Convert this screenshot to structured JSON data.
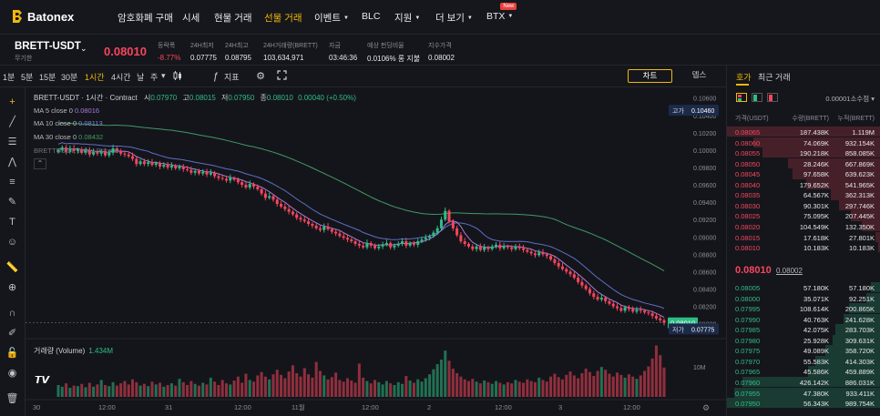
{
  "brand": {
    "name": "Batonex",
    "accent": "#f0b90b"
  },
  "nav": {
    "items": [
      {
        "label": "암호화폐 구매",
        "caret": false
      },
      {
        "label": "시세",
        "caret": false
      },
      {
        "label": "현물 거래",
        "caret": false
      },
      {
        "label": "선물 거래",
        "caret": false,
        "active": true
      },
      {
        "label": "이벤트",
        "caret": true
      },
      {
        "label": "BLC",
        "caret": false
      },
      {
        "label": "지원",
        "caret": true
      },
      {
        "label": "더 보기",
        "caret": true
      },
      {
        "label": "BTX",
        "caret": true,
        "badge": "New"
      }
    ]
  },
  "ticker": {
    "symbol": "BRETT-USDT",
    "subtitle": "무기한",
    "last_price": "0.08010",
    "stats": [
      {
        "label": "등락폭",
        "value": "-8.77%",
        "negative": true
      },
      {
        "label": "24H최저",
        "value": "0.07775"
      },
      {
        "label": "24H최고",
        "value": "0.08795"
      },
      {
        "label": "24H거래량(BRETT)",
        "value": "103,634,971"
      },
      {
        "label": "자금",
        "value": "03:46:36"
      },
      {
        "label": "예상 펀딩비율",
        "value": "0.0106% 롱 지불"
      },
      {
        "label": "지수가격",
        "value": "0.08002"
      }
    ]
  },
  "toolbar": {
    "timeframes": [
      "1분",
      "5분",
      "15분",
      "30분",
      "1시간",
      "4시간",
      "날",
      "주"
    ],
    "active_timeframe": "1시간",
    "indicator_label": "지표",
    "view_chart": "차트",
    "view_depth": "뎁스"
  },
  "chart_legend": {
    "title": "BRETT-USDT · 1시간 · Contract",
    "open_label": "시",
    "open": "0.07970",
    "high_label": "고",
    "high": "0.08015",
    "low_label": "저",
    "low": "0.07950",
    "close_label": "종",
    "close": "0.08010",
    "change": "0.00040 (+0.50%)",
    "ma5_label": "MA 5 close 0",
    "ma5": "0.08016",
    "ma10_label": "MA 10 close 0",
    "ma10": "0.08113",
    "ma30_label": "MA 30 close 0",
    "ma30": "0.08432",
    "index_label": "BRETTUSDT, Index Price",
    "volume_label": "거래량 (Volume)",
    "volume_value": "1.434M",
    "high_tag_label": "고가",
    "high_tag_value": "0.10460",
    "low_tag_label": "저가",
    "low_tag_value": "0.07775",
    "current_price_tag": "0.08010",
    "volume_axis_label": "10M"
  },
  "chart_data": {
    "type": "candlestick",
    "xlabel": "",
    "ylabel": "",
    "ylim": [
      0.0786,
      0.1066
    ],
    "y_ticks": [
      "0.10600",
      "0.10400",
      "0.10200",
      "0.10000",
      "0.09800",
      "0.09600",
      "0.09400",
      "0.09200",
      "0.09000",
      "0.08800",
      "0.08600",
      "0.08400",
      "0.08200",
      "0.08000"
    ],
    "x_ticks": [
      "30",
      "12:00",
      "31",
      "12:00",
      "11월",
      "12:00",
      "2",
      "12:00",
      "3",
      "12:00"
    ],
    "grid": false,
    "price_series": [
      0.1,
      0.1003,
      0.0998,
      0.1002,
      0.0999,
      0.1001,
      0.0997,
      0.1,
      0.0995,
      0.0998,
      0.0996,
      0.0999,
      0.0994,
      0.0997,
      0.1002,
      0.0999,
      0.0996,
      0.0995,
      0.0993,
      0.099,
      0.0984,
      0.0987,
      0.0984,
      0.0986,
      0.0983,
      0.0985,
      0.0981,
      0.0983,
      0.098,
      0.0982,
      0.0979,
      0.0981,
      0.0978,
      0.0977,
      0.0974,
      0.0976,
      0.0973,
      0.0975,
      0.0972,
      0.0974,
      0.097,
      0.0968,
      0.0967,
      0.0965,
      0.0968,
      0.0966,
      0.0963,
      0.096,
      0.0957,
      0.0961,
      0.0958,
      0.0955,
      0.095,
      0.0945,
      0.0947,
      0.0943,
      0.0938,
      0.0935,
      0.0932,
      0.0929,
      0.0926,
      0.0922,
      0.092,
      0.0918,
      0.0915,
      0.0913,
      0.091,
      0.0908,
      0.0912,
      0.0909,
      0.0906,
      0.0904,
      0.0901,
      0.0899,
      0.0897,
      0.0895,
      0.0892,
      0.089,
      0.0888,
      0.0893,
      0.089,
      0.0887,
      0.0889,
      0.0891,
      0.0893,
      0.0888,
      0.089,
      0.0892,
      0.0895,
      0.089,
      0.0893,
      0.0891,
      0.0895,
      0.0897,
      0.0899,
      0.0901,
      0.0905,
      0.091,
      0.092,
      0.093,
      0.0918,
      0.091,
      0.0902,
      0.0895,
      0.0892,
      0.0889,
      0.0886,
      0.0889,
      0.0885,
      0.0888,
      0.0886,
      0.0889,
      0.0891,
      0.0887,
      0.0889,
      0.0888,
      0.0886,
      0.0889,
      0.0887,
      0.0885,
      0.0883,
      0.0881,
      0.0879,
      0.0882,
      0.088,
      0.0878,
      0.0874,
      0.087,
      0.0866,
      0.0863,
      0.086,
      0.0857,
      0.0853,
      0.0848,
      0.0844,
      0.084,
      0.0835,
      0.0831,
      0.0828,
      0.083,
      0.0826,
      0.0823,
      0.082,
      0.0818,
      0.0815,
      0.0819,
      0.0817,
      0.0814,
      0.0816,
      0.0815,
      0.0813,
      0.0812,
      0.0809,
      0.0806,
      0.0804,
      0.0801
    ],
    "volume_series": [
      2.1,
      1.8,
      2.4,
      1.6,
      2.0,
      1.9,
      2.3,
      1.7,
      2.5,
      1.8,
      2.2,
      3.0,
      2.1,
      1.9,
      2.6,
      2.0,
      2.4,
      2.8,
      2.2,
      3.1,
      2.6,
      2.0,
      2.3,
      1.9,
      2.7,
      2.2,
      2.5,
      1.8,
      2.1,
      2.4,
      2.0,
      3.2,
      2.6,
      2.1,
      2.8,
      2.3,
      2.0,
      2.5,
      2.2,
      3.4,
      2.7,
      2.1,
      3.0,
      2.4,
      2.2,
      2.9,
      3.6,
      2.5,
      4.1,
      3.0,
      2.7,
      3.8,
      4.4,
      3.6,
      3.1,
      4.0,
      4.8,
      3.9,
      3.3,
      4.5,
      5.6,
      4.2,
      3.6,
      5.1,
      4.0,
      3.4,
      6.2,
      4.6,
      3.8,
      3.1,
      3.5,
      4.3,
      3.0,
      2.7,
      3.3,
      2.9,
      2.5,
      5.9,
      3.4,
      2.8,
      2.4,
      3.0,
      2.6,
      2.2,
      2.8,
      2.4,
      2.1,
      2.6,
      2.3,
      3.7,
      2.9,
      2.5,
      3.1,
      2.7,
      3.3,
      4.0,
      4.9,
      5.8,
      6.6,
      8.2,
      6.4,
      5.0,
      4.2,
      3.6,
      3.1,
      2.8,
      3.2,
      2.7,
      2.4,
      2.9,
      2.6,
      2.3,
      2.8,
      2.5,
      2.2,
      2.6,
      2.4,
      3.0,
      2.7,
      2.5,
      3.1,
      2.8,
      2.6,
      3.4,
      3.0,
      2.7,
      3.6,
      4.1,
      3.5,
      3.1,
      3.9,
      4.5,
      3.8,
      3.3,
      4.2,
      5.0,
      4.4,
      3.7,
      4.6,
      5.3,
      4.8,
      4.1,
      3.6,
      4.3,
      3.9,
      3.4,
      4.0,
      3.6,
      3.2,
      3.8,
      4.6,
      5.4,
      6.8,
      9.1,
      7.4,
      5.2
    ],
    "ma10_series_note": "",
    "ma30_series_note": ""
  },
  "orderbook": {
    "tab_book": "호가",
    "tab_trades": "최근 거래",
    "precision": "0.00001소수점",
    "col_price": "가격(USDT)",
    "col_size": "수량(BRETT)",
    "col_total": "누적(BRETT)",
    "mid_price": "0.08010",
    "mark_price": "0.08002",
    "asks": [
      {
        "price": "0.08065",
        "size": "187.438K",
        "total": "1.119M",
        "depth": 1.0
      },
      {
        "price": "0.08060",
        "size": "74.069K",
        "total": "932.154K",
        "depth": 0.83
      },
      {
        "price": "0.08055",
        "size": "190.218K",
        "total": "858.085K",
        "depth": 0.77
      },
      {
        "price": "0.08050",
        "size": "28.246K",
        "total": "667.869K",
        "depth": 0.6
      },
      {
        "price": "0.08045",
        "size": "97.658K",
        "total": "639.623K",
        "depth": 0.57
      },
      {
        "price": "0.08040",
        "size": "179.652K",
        "total": "541.965K",
        "depth": 0.48
      },
      {
        "price": "0.08035",
        "size": "64.567K",
        "total": "362.313K",
        "depth": 0.32
      },
      {
        "price": "0.08030",
        "size": "90.301K",
        "total": "297.746K",
        "depth": 0.27
      },
      {
        "price": "0.08025",
        "size": "75.095K",
        "total": "207.445K",
        "depth": 0.19
      },
      {
        "price": "0.08020",
        "size": "104.549K",
        "total": "132.350K",
        "depth": 0.12
      },
      {
        "price": "0.08015",
        "size": "17.618K",
        "total": "27.801K",
        "depth": 0.03
      },
      {
        "price": "0.08010",
        "size": "10.183K",
        "total": "10.183K",
        "depth": 0.01
      }
    ],
    "bids": [
      {
        "price": "0.08005",
        "size": "57.180K",
        "total": "57.180K",
        "depth": 0.06
      },
      {
        "price": "0.08000",
        "size": "35.071K",
        "total": "92.251K",
        "depth": 0.09
      },
      {
        "price": "0.07995",
        "size": "108.614K",
        "total": "200.865K",
        "depth": 0.2
      },
      {
        "price": "0.07990",
        "size": "40.763K",
        "total": "241.628K",
        "depth": 0.24
      },
      {
        "price": "0.07985",
        "size": "42.075K",
        "total": "283.703K",
        "depth": 0.29
      },
      {
        "price": "0.07980",
        "size": "25.928K",
        "total": "309.631K",
        "depth": 0.31
      },
      {
        "price": "0.07975",
        "size": "49.089K",
        "total": "358.720K",
        "depth": 0.36
      },
      {
        "price": "0.07970",
        "size": "55.583K",
        "total": "414.303K",
        "depth": 0.42
      },
      {
        "price": "0.07965",
        "size": "45.586K",
        "total": "459.889K",
        "depth": 0.47
      },
      {
        "price": "0.07960",
        "size": "426.142K",
        "total": "886.031K",
        "depth": 0.9
      },
      {
        "price": "0.07955",
        "size": "47.380K",
        "total": "933.411K",
        "depth": 0.95
      },
      {
        "price": "0.07950",
        "size": "56.343K",
        "total": "989.754K",
        "depth": 1.0
      }
    ]
  },
  "colors": {
    "up": "#2ebd85",
    "down": "#f6465d",
    "ma5": "#a77bd8",
    "ma10": "#5e6ec7",
    "ma30": "#3f9a64"
  }
}
